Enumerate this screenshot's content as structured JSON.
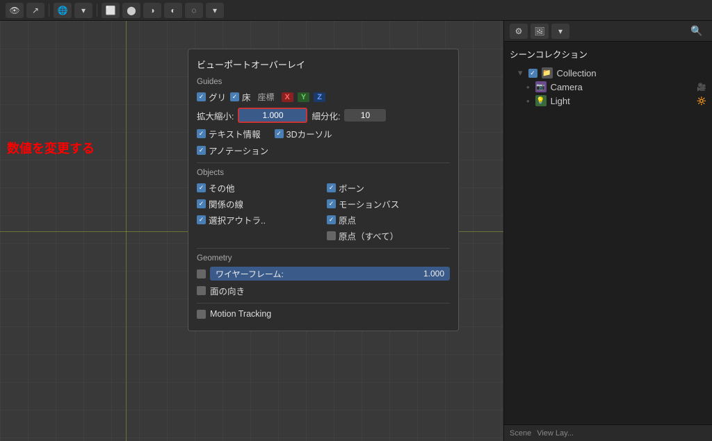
{
  "toolbar": {
    "icons": [
      "👁",
      "↗",
      "🌐",
      "⬜",
      "⬤",
      "⬤",
      "⬤",
      "⬤"
    ]
  },
  "annotation": {
    "text": "数値を変更する"
  },
  "overlay_panel": {
    "title": "ビューポートオーバーレイ",
    "sections": {
      "guides": {
        "label": "Guides",
        "items": [
          {
            "label": "グリ",
            "checked": true
          },
          {
            "label": "床",
            "checked": true
          },
          {
            "label": "座標"
          }
        ],
        "axes": [
          "X",
          "Y",
          "Z"
        ],
        "scale_label": "拡大縮小:",
        "scale_value": "1.000",
        "subdivision_label": "細分化:",
        "subdivision_value": "10",
        "text_info": "テキスト情報",
        "cursor_3d": "3Dカーソル",
        "annotation": "アノテーション"
      },
      "objects": {
        "label": "Objects",
        "items_left": [
          {
            "label": "その他",
            "checked": true
          },
          {
            "label": "関係の線",
            "checked": true
          },
          {
            "label": "選択アウトラ..",
            "checked": true
          }
        ],
        "items_right": [
          {
            "label": "ボーン",
            "checked": true
          },
          {
            "label": "モーションバス",
            "checked": true
          },
          {
            "label": "原点",
            "checked": true
          },
          {
            "label": "原点（すべて）",
            "checked": false
          }
        ]
      },
      "geometry": {
        "label": "Geometry",
        "wireframe_label": "ワイヤーフレーム:",
        "wireframe_value": "1.000",
        "face_dir": "面の向き",
        "motion_tracking": "Motion Tracking"
      }
    }
  },
  "outliner": {
    "title": "シーンコレクション",
    "items": [
      {
        "label": "Collection",
        "type": "collection",
        "indent": 1
      },
      {
        "label": "Camera",
        "type": "camera",
        "indent": 2
      },
      {
        "label": "Light",
        "type": "light",
        "indent": 2
      }
    ]
  },
  "bottom": {
    "left": "Scene",
    "right": "View Lay..."
  }
}
